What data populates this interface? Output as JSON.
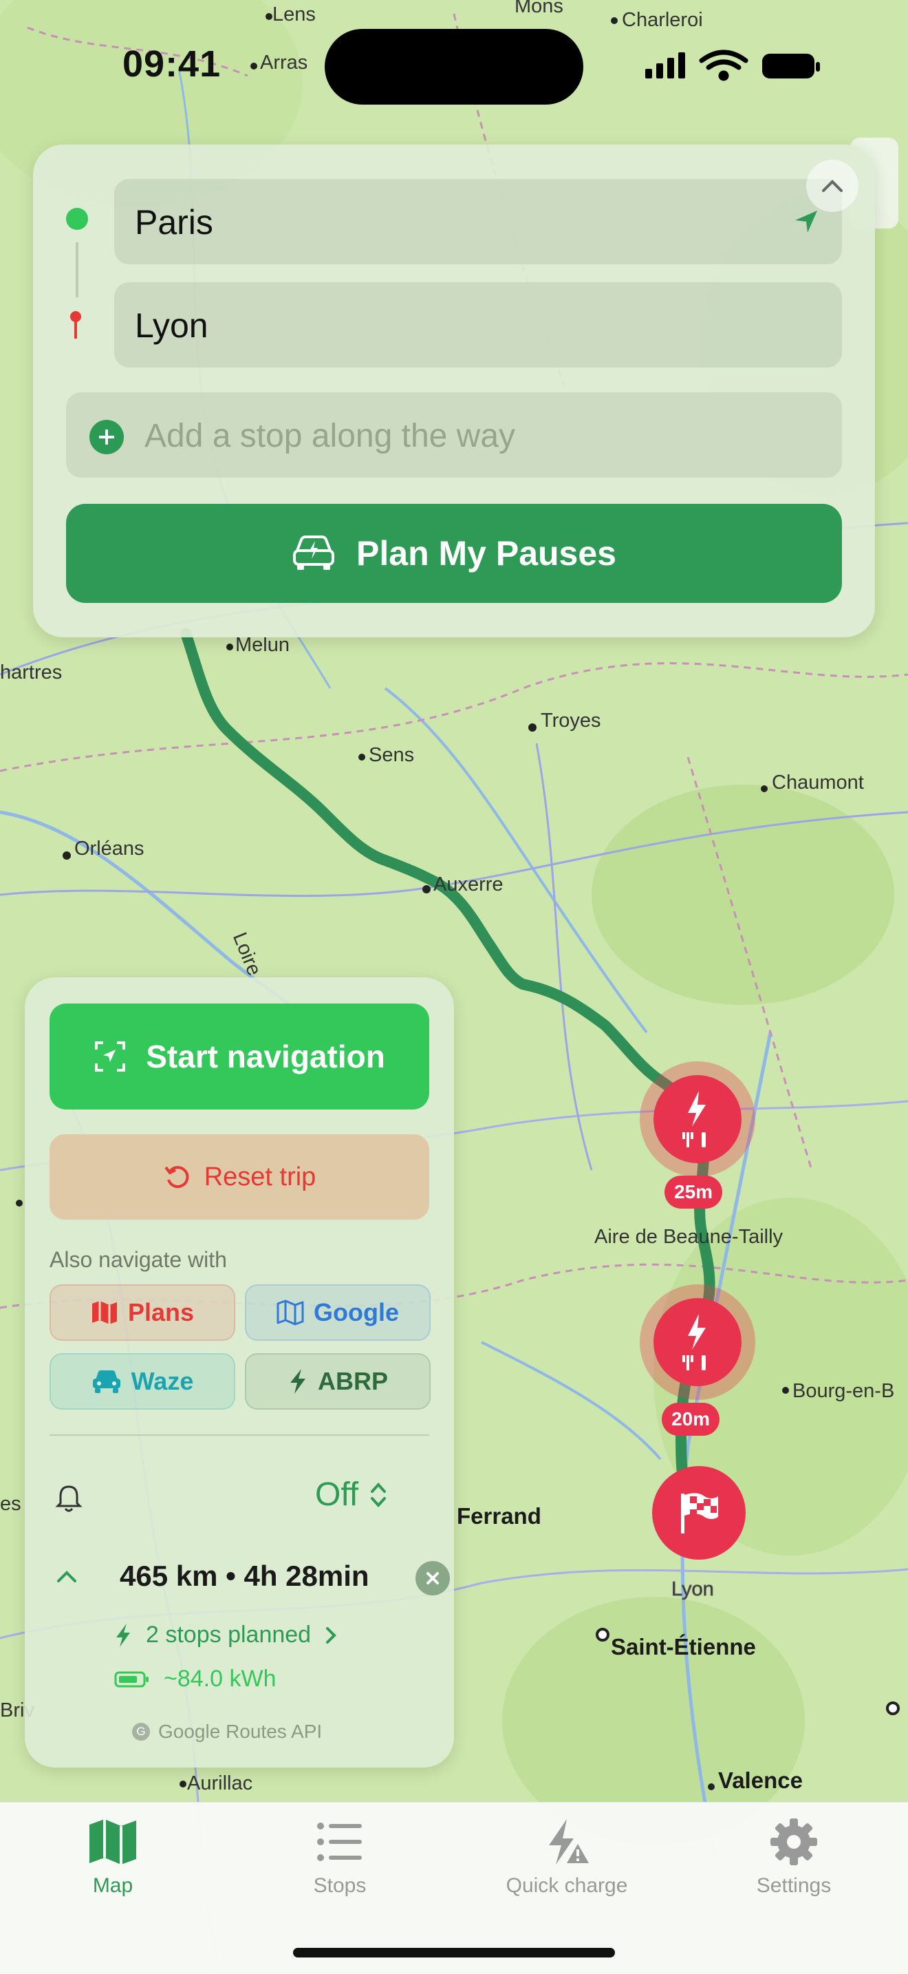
{
  "status_bar": {
    "time": "09:41"
  },
  "map": {
    "labels": [
      "Lens",
      "Mons",
      "Charleroi",
      "Arras",
      "Melun",
      "hartres",
      "Troyes",
      "Sens",
      "Chaumont",
      "Orléans",
      "Auxerre",
      "Loire",
      "Aire de Beaune-Tailly",
      "Bourg-en-B",
      "Ferrand",
      "Lyon",
      "Saint-Étienne",
      "Valence",
      "Aurillac",
      "Briv",
      "es"
    ],
    "stop_durations": [
      "25m",
      "20m"
    ]
  },
  "route_form": {
    "origin": "Paris",
    "destination": "Lyon",
    "add_stop_placeholder": "Add a stop along the way",
    "plan_button": "Plan My Pauses"
  },
  "panel": {
    "start_navigation": "Start navigation",
    "reset_trip": "Reset trip",
    "also_navigate_with": "Also navigate with",
    "apps": [
      {
        "label": "Plans",
        "color": "#e53935"
      },
      {
        "label": "Google",
        "color": "#2f7ad6"
      },
      {
        "label": "Waze",
        "color": "#1aa3b0"
      },
      {
        "label": "ABRP",
        "color": "#2d6b3c"
      }
    ],
    "alert_value": "Off",
    "summary": "465 km • 4h 28min",
    "stops_planned": "2 stops planned",
    "energy": "~84.0 kWh",
    "attribution": "Google Routes API"
  },
  "tabs": [
    {
      "label": "Map",
      "icon": "map-icon",
      "active": true
    },
    {
      "label": "Stops",
      "icon": "list-icon",
      "active": false
    },
    {
      "label": "Quick charge",
      "icon": "bolt-warning-icon",
      "active": false
    },
    {
      "label": "Settings",
      "icon": "gear-icon",
      "active": false
    }
  ],
  "colors": {
    "primary_green": "#2f9a55",
    "bright_green": "#34c759",
    "stop_red": "#e8334f"
  }
}
